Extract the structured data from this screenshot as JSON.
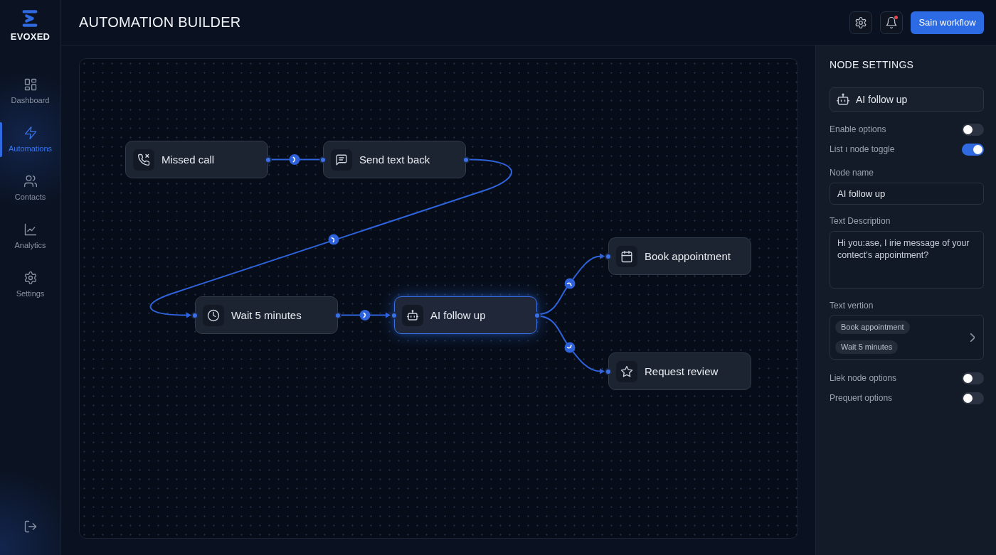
{
  "sidebar": {
    "brand": "EVOXED",
    "items": [
      {
        "label": "Dashboard",
        "selected": false
      },
      {
        "label": "Automations",
        "selected": true
      },
      {
        "label": "Contacts",
        "selected": false
      },
      {
        "label": "Analytics",
        "selected": false
      },
      {
        "label": "Settings",
        "selected": false
      }
    ]
  },
  "topbar": {
    "title": "AUTOMATION BUILDER",
    "notifications_unread": true,
    "primary_button": "Sain workflow"
  },
  "canvas": {
    "nodes": [
      {
        "label": "Missed call",
        "selected": false
      },
      {
        "label": "Send text back",
        "selected": false
      },
      {
        "label": "Wait 5 minutes",
        "selected": false
      },
      {
        "label": "AI follow up",
        "selected": true
      },
      {
        "label": "Book appointment",
        "selected": false
      },
      {
        "label": "Request review",
        "selected": false
      }
    ]
  },
  "node_settings": {
    "title": "NODE SETTINGS",
    "node_label": "AI follow up",
    "rows": [
      {
        "kind": "toggle",
        "label": "Enable options",
        "on": false
      },
      {
        "kind": "toggle",
        "label": "List ı node toggle",
        "on": true
      },
      {
        "kind": "input",
        "label": "Node name",
        "value": "AI follow up"
      },
      {
        "kind": "textarea",
        "label": "Text Description",
        "value": "Hi you:ase, I irie message of your contect's appointment?"
      },
      {
        "kind": "chips",
        "label": "Text vertion",
        "chips": [
          "Book appointment",
          "Wait 5 minutes"
        ]
      },
      {
        "kind": "toggle",
        "label": "Liek node options",
        "on": false
      },
      {
        "kind": "toggle",
        "label": "Prequert options",
        "on": false
      }
    ]
  }
}
